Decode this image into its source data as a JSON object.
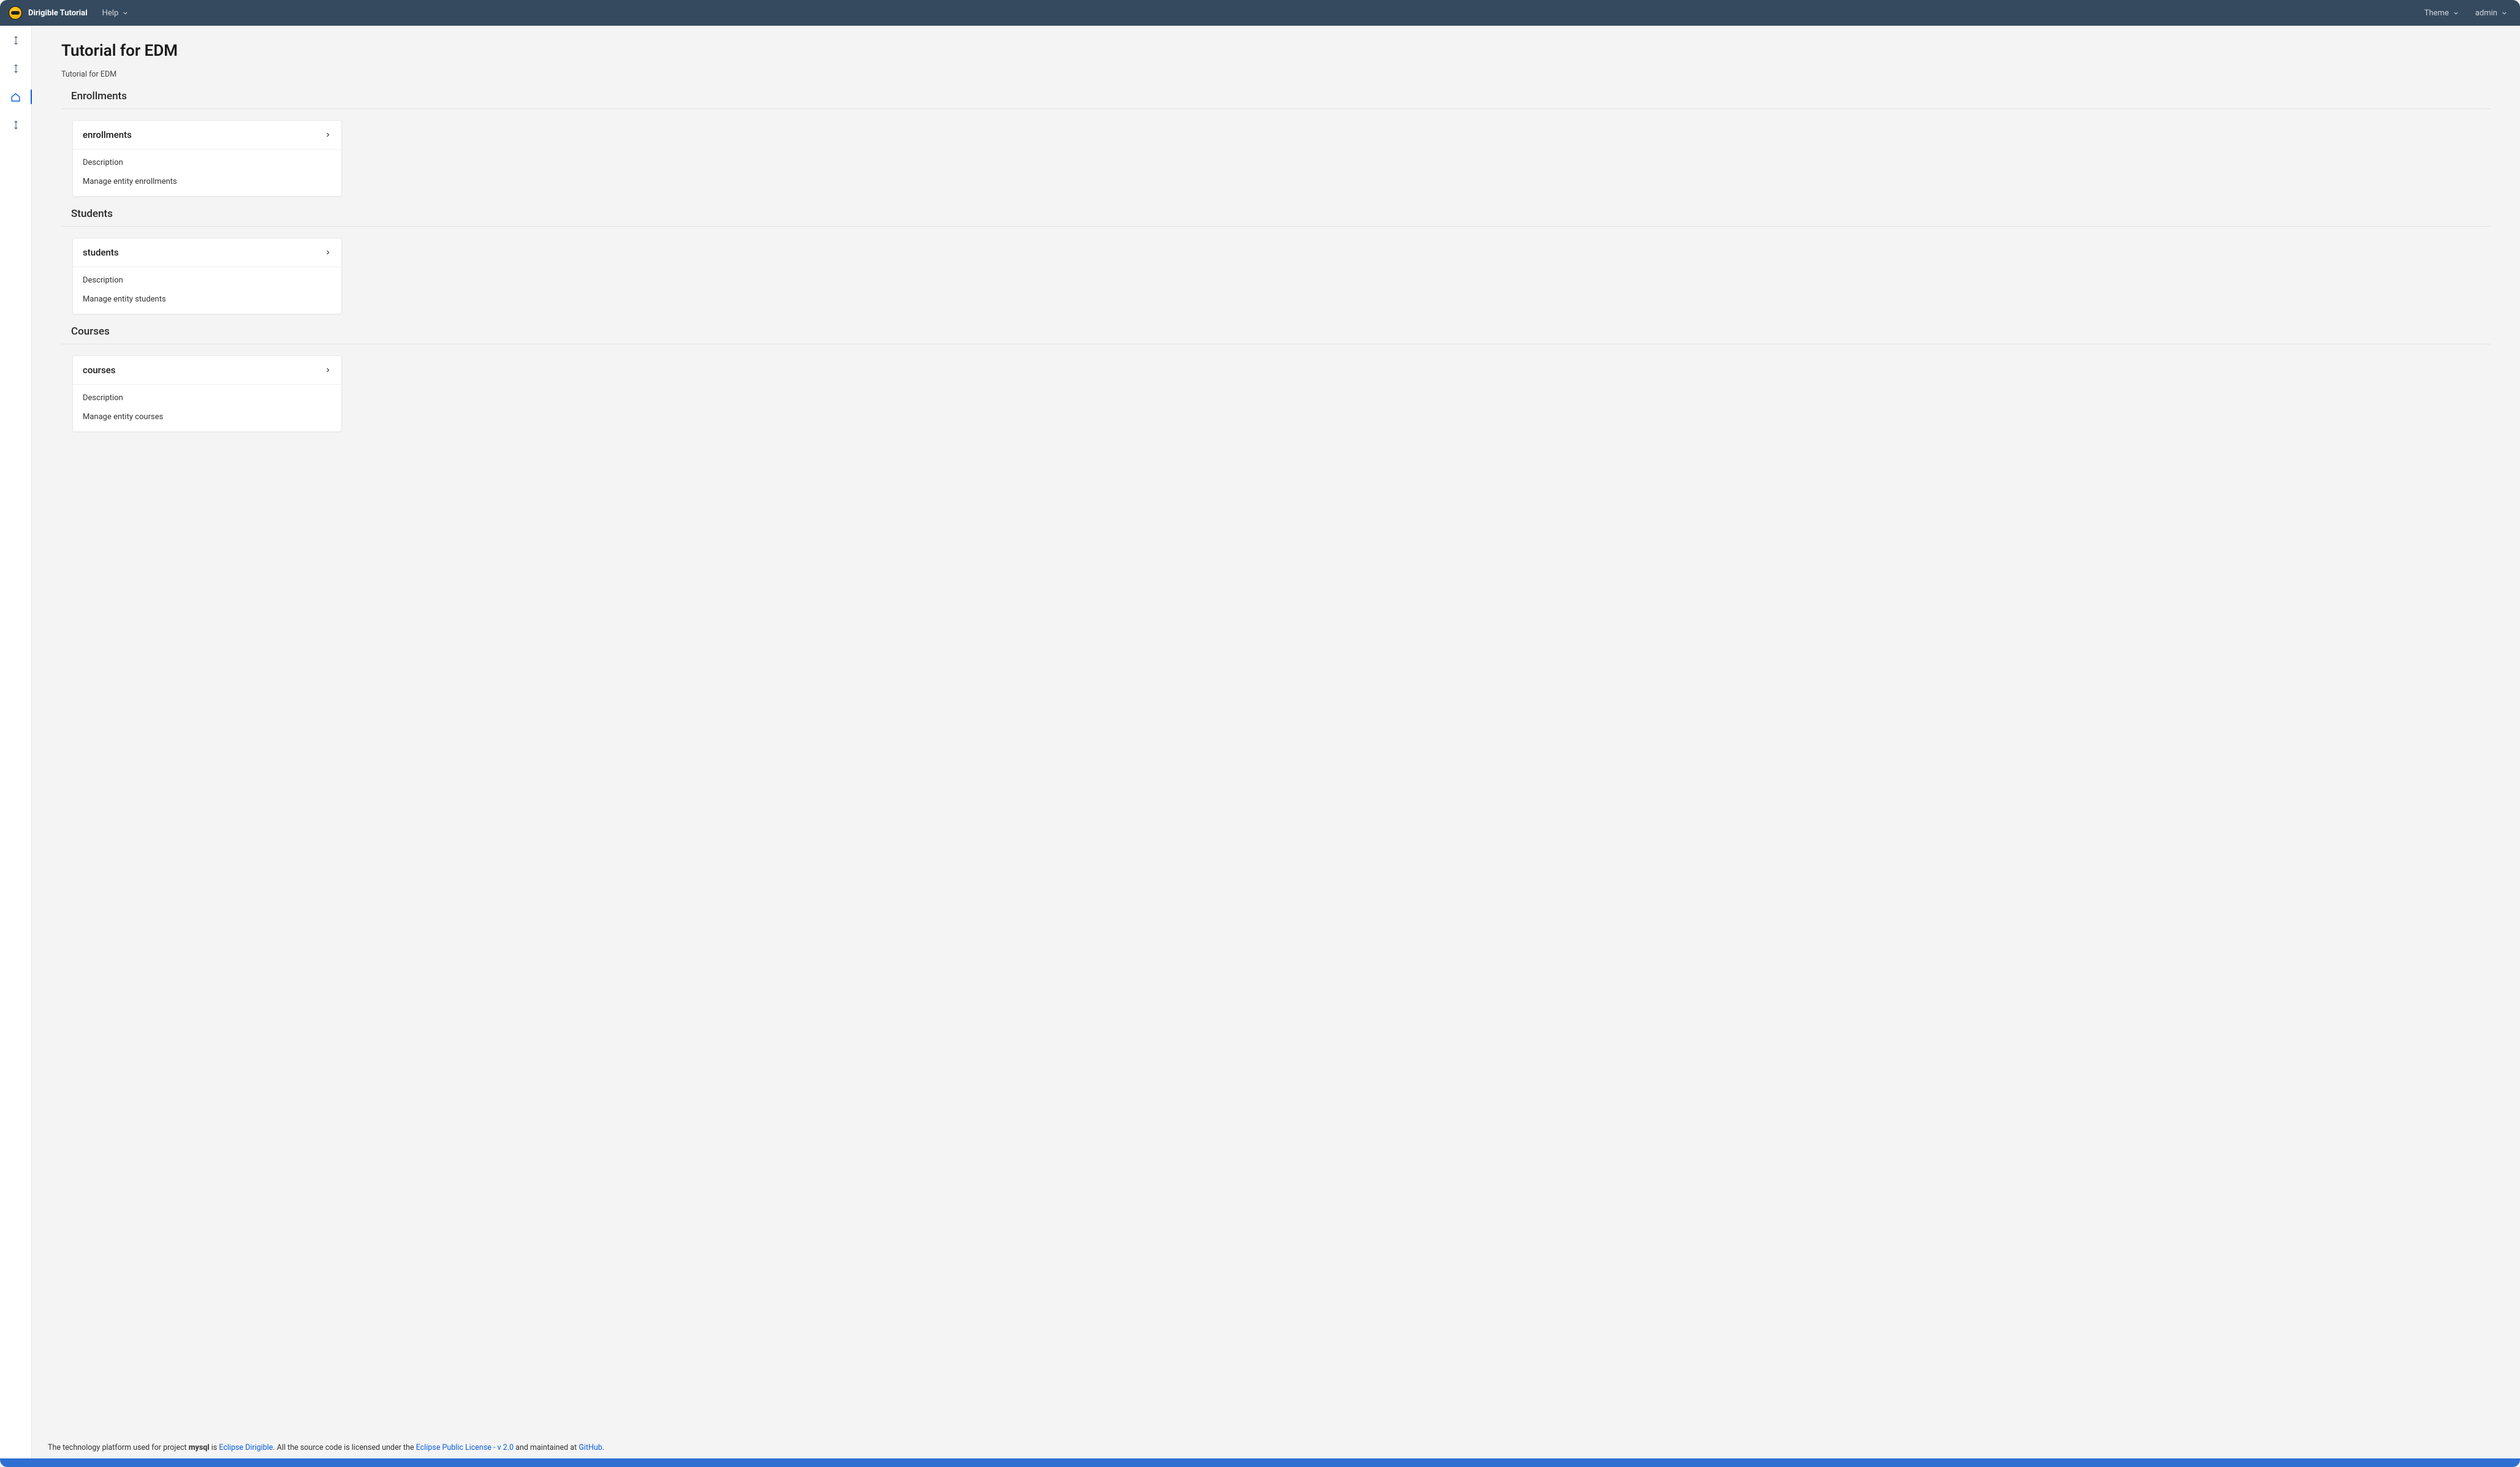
{
  "topbar": {
    "brand": "Dirigible Tutorial",
    "help": "Help",
    "theme": "Theme",
    "user": "admin"
  },
  "page": {
    "title": "Tutorial for EDM",
    "breadcrumb": "Tutorial for EDM"
  },
  "sections": [
    {
      "title": "Enrollments",
      "tile": {
        "title": "enrollments",
        "label": "Description",
        "sub": "Manage entity enrollments"
      }
    },
    {
      "title": "Students",
      "tile": {
        "title": "students",
        "label": "Description",
        "sub": "Manage entity students"
      }
    },
    {
      "title": "Courses",
      "tile": {
        "title": "courses",
        "label": "Description",
        "sub": "Manage entity courses"
      }
    }
  ],
  "footer": {
    "pre": "The technology platform used for project ",
    "project": "mysql",
    "mid1": " is ",
    "link1": "Eclipse Dirigible",
    "mid2": ". All the source code is licensed under the ",
    "link2": "Eclipse Public License - v 2.0",
    "mid3": " and maintained at ",
    "link3": "GitHub",
    "tail": "."
  }
}
